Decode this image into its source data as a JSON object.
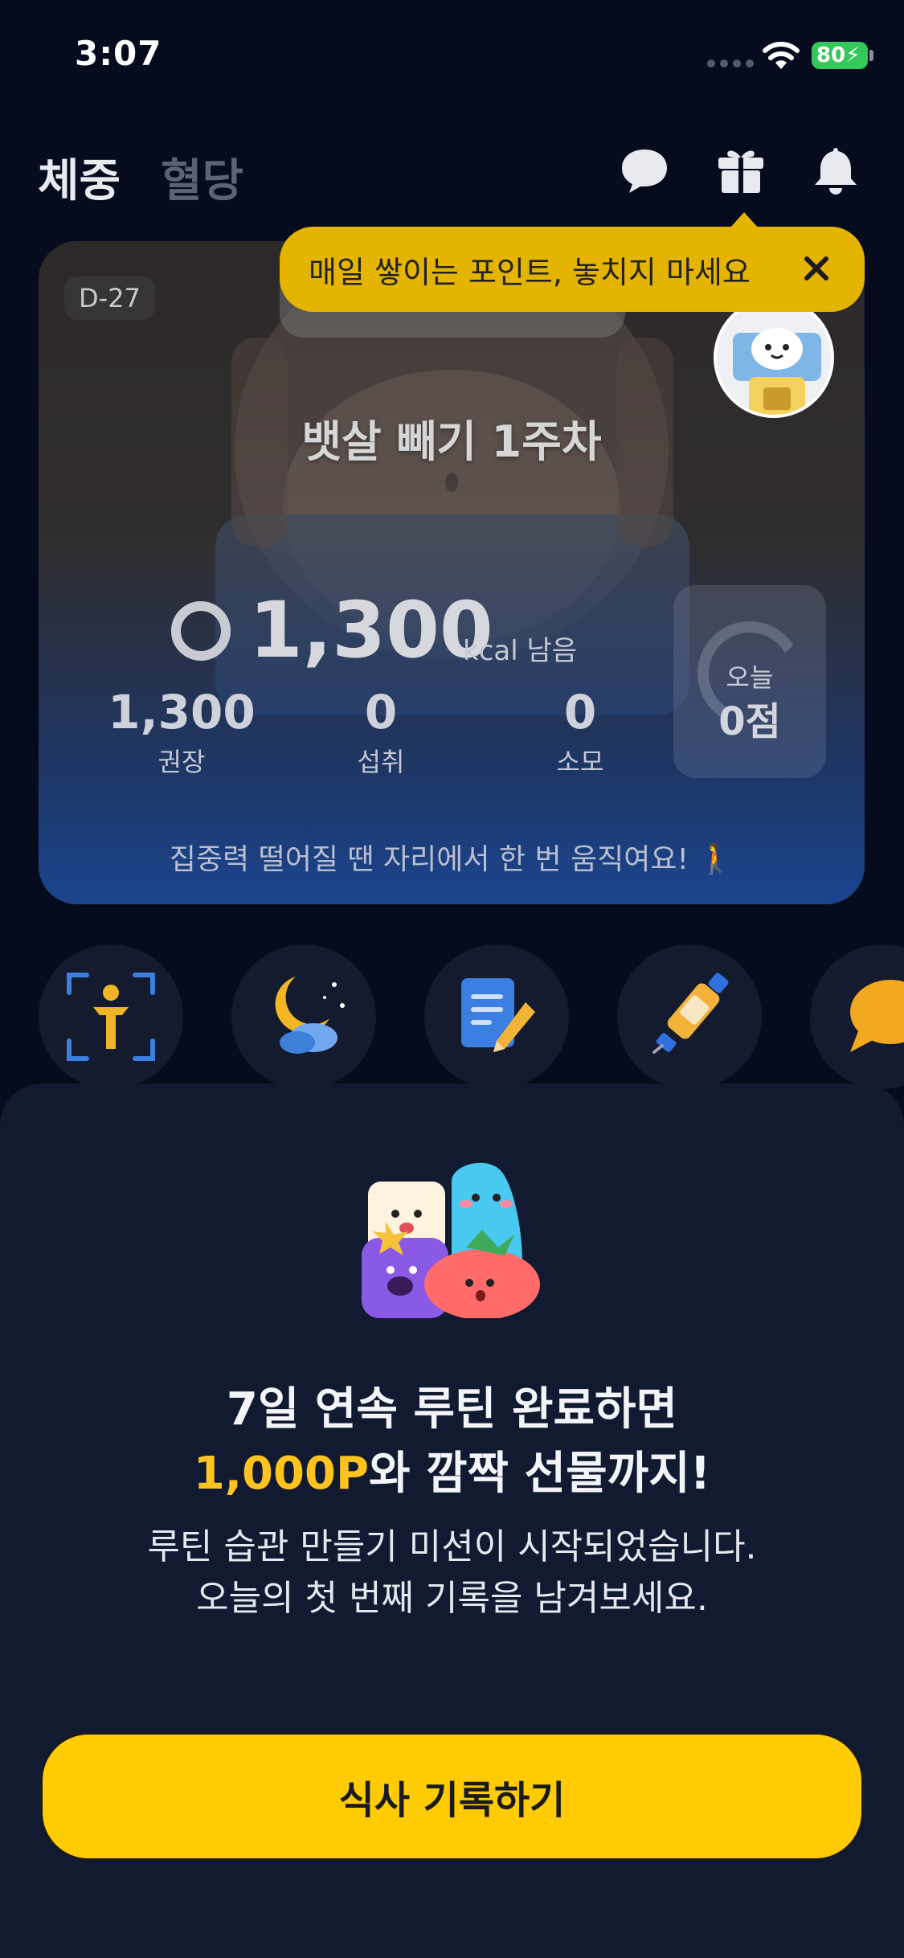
{
  "status_bar": {
    "time": "3:07",
    "battery": "80"
  },
  "header": {
    "tabs": [
      {
        "label": "체중",
        "active": true
      },
      {
        "label": "혈당",
        "active": false
      }
    ],
    "icons": [
      "chat-bubble-icon",
      "gift-icon",
      "bell-icon"
    ]
  },
  "tooltip": {
    "text": "매일 쌓이는 포인트, 놓치지 마세요"
  },
  "hero": {
    "dday": "D-27",
    "title": "뱃살 빼기 1주차",
    "kcal_remaining": "1,300",
    "kcal_unit": "kcal 남음",
    "stats": [
      {
        "value": "1,300",
        "label": "권장"
      },
      {
        "value": "0",
        "label": "섭취"
      },
      {
        "value": "0",
        "label": "소모"
      }
    ],
    "today": {
      "label": "오늘",
      "value": "0점"
    },
    "tip": "집중력 떨어질 땐 자리에서 한 번 움직여요! 🚶"
  },
  "shortcuts": [
    "body-scan-icon",
    "moon-cloud-icon",
    "note-pencil-icon",
    "medicine-pen-icon",
    "speech-bubble-icon"
  ],
  "sheet": {
    "title_line1": "7일 연속 루틴 완료하면",
    "title_line2_highlight": "1,000P",
    "title_line2_rest": "와 깜짝 선물까지!",
    "desc_line1": "루틴 습관 만들기 미션이 시작되었습니다.",
    "desc_line2": "오늘의 첫 번째 기록을 남겨보세요.",
    "cta_label": "식사 기록하기"
  },
  "colors": {
    "accent": "#ffcb05",
    "tooltip": "#e5b400",
    "highlight": "#ffc31f",
    "background": "#060b1e",
    "sheet": "#111a31"
  }
}
